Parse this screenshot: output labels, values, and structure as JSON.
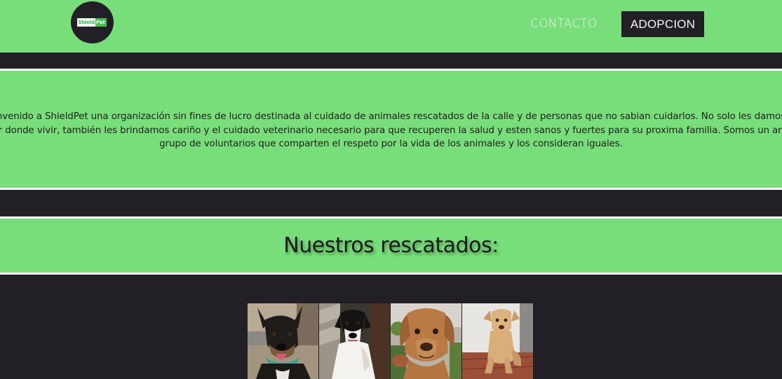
{
  "header": {
    "logo": {
      "text_left": "Shield",
      "text_right": "Pet",
      "colors": {
        "circle": "#222026",
        "left_bg": "#ffffff",
        "left_fg": "#31b84a",
        "right_bg": "#44c14f"
      }
    },
    "nav": [
      {
        "label": "CONTACTO"
      },
      {
        "label": "ADOPCION"
      }
    ]
  },
  "intro": {
    "text": "Bienvenido a ShieldPet una organización sin fines de lucro destinada al cuidado de animales rescatados de la calle y de personas que no sabian cuidarlos. No solo les damos un lugar donde vivir, también les brindamos cariño y el cuidado veterinario necesario para que recuperen la salud y esten sanos y fuertes para su proxima familia. Somos un amplio grupo de voluntarios que comparten el respeto por la vida de los animales y los consideran iguales."
  },
  "rescued": {
    "title": "Nuestros rescatados:"
  },
  "gallery": {
    "photos": [
      {
        "subject": "black-and-tan puppy"
      },
      {
        "subject": "black-and-white puppy"
      },
      {
        "subject": "brown puppy close-up"
      },
      {
        "subject": "tan puppy sitting"
      }
    ]
  },
  "colors": {
    "accent_green": "#78DE7A",
    "dark": "#222026",
    "separator": "#ffffff"
  }
}
